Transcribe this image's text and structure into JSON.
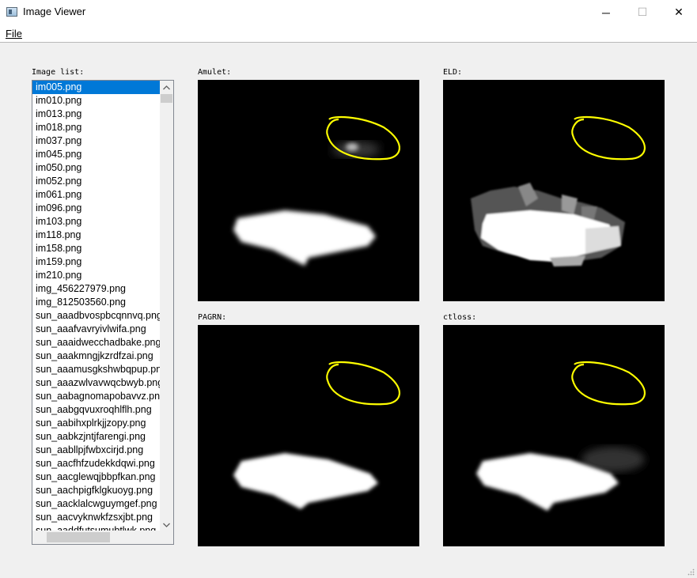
{
  "window": {
    "title": "Image Viewer",
    "minimize_glyph": "─",
    "maximize_glyph": "☐",
    "close_glyph": "✕"
  },
  "menu": {
    "file": "File"
  },
  "image_list": {
    "label": "Image list:",
    "selected_index": 0,
    "items": [
      "im005.png",
      "im010.png",
      "im013.png",
      "im018.png",
      "im037.png",
      "im045.png",
      "im050.png",
      "im052.png",
      "im061.png",
      "im096.png",
      "im103.png",
      "im118.png",
      "im158.png",
      "im159.png",
      "im210.png",
      "img_456227979.png",
      "img_812503560.png",
      "sun_aaadbvospbcqnnvq.png",
      "sun_aaafvavryivlwifa.png",
      "sun_aaaidwecchadbake.png",
      "sun_aaakmngjkzrdfzai.png",
      "sun_aaamusgkshwbqpup.png",
      "sun_aaazwlvavwqcbwyb.png",
      "sun_aabagnomapobavvz.png",
      "sun_aabgqvuxroqhlflh.png",
      "sun_aabihxplrkjjzopy.png",
      "sun_aabkzjntjfarengi.png",
      "sun_aabllpjfwbxcirjd.png",
      "sun_aacfhfzudekkdqwi.png",
      "sun_aacglewqjbbpfkan.png",
      "sun_aachpigfklgkuoyg.png",
      "sun_aacklalcwguymgef.png",
      "sun_aacvyknwkfzsxjbt.png",
      "sun_aaddfutsumubtlwk.png"
    ]
  },
  "panels": {
    "amulet": "Amulet:",
    "eld": "ELD:",
    "pagrn": "PAGRN:",
    "ctloss": "ctloss:"
  },
  "icons": {
    "app": "image-viewer-app-icon",
    "scroll_up": "chevron-up-icon",
    "scroll_down": "chevron-down-icon",
    "resize": "resize-grip-icon"
  },
  "colors": {
    "selection": "#0078d7",
    "annotation": "#ffff00",
    "panel_bg": "#000000"
  }
}
